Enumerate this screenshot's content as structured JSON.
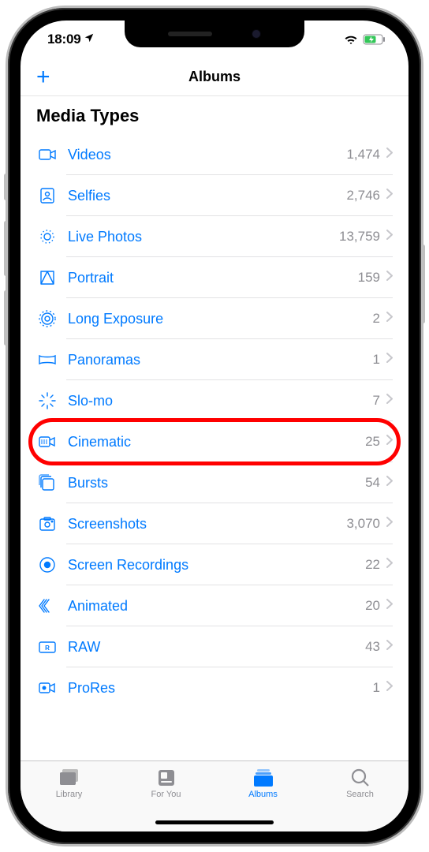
{
  "status": {
    "time": "18:09"
  },
  "nav": {
    "title": "Albums"
  },
  "section": {
    "title": "Media Types"
  },
  "rows": [
    {
      "label": "Videos",
      "count": "1,474"
    },
    {
      "label": "Selfies",
      "count": "2,746"
    },
    {
      "label": "Live Photos",
      "count": "13,759"
    },
    {
      "label": "Portrait",
      "count": "159"
    },
    {
      "label": "Long Exposure",
      "count": "2"
    },
    {
      "label": "Panoramas",
      "count": "1"
    },
    {
      "label": "Slo-mo",
      "count": "7"
    },
    {
      "label": "Cinematic",
      "count": "25"
    },
    {
      "label": "Bursts",
      "count": "54"
    },
    {
      "label": "Screenshots",
      "count": "3,070"
    },
    {
      "label": "Screen Recordings",
      "count": "22"
    },
    {
      "label": "Animated",
      "count": "20"
    },
    {
      "label": "RAW",
      "count": "43"
    },
    {
      "label": "ProRes",
      "count": "1"
    }
  ],
  "tabs": [
    {
      "label": "Library"
    },
    {
      "label": "For You"
    },
    {
      "label": "Albums"
    },
    {
      "label": "Search"
    }
  ],
  "highlight_index": 7
}
